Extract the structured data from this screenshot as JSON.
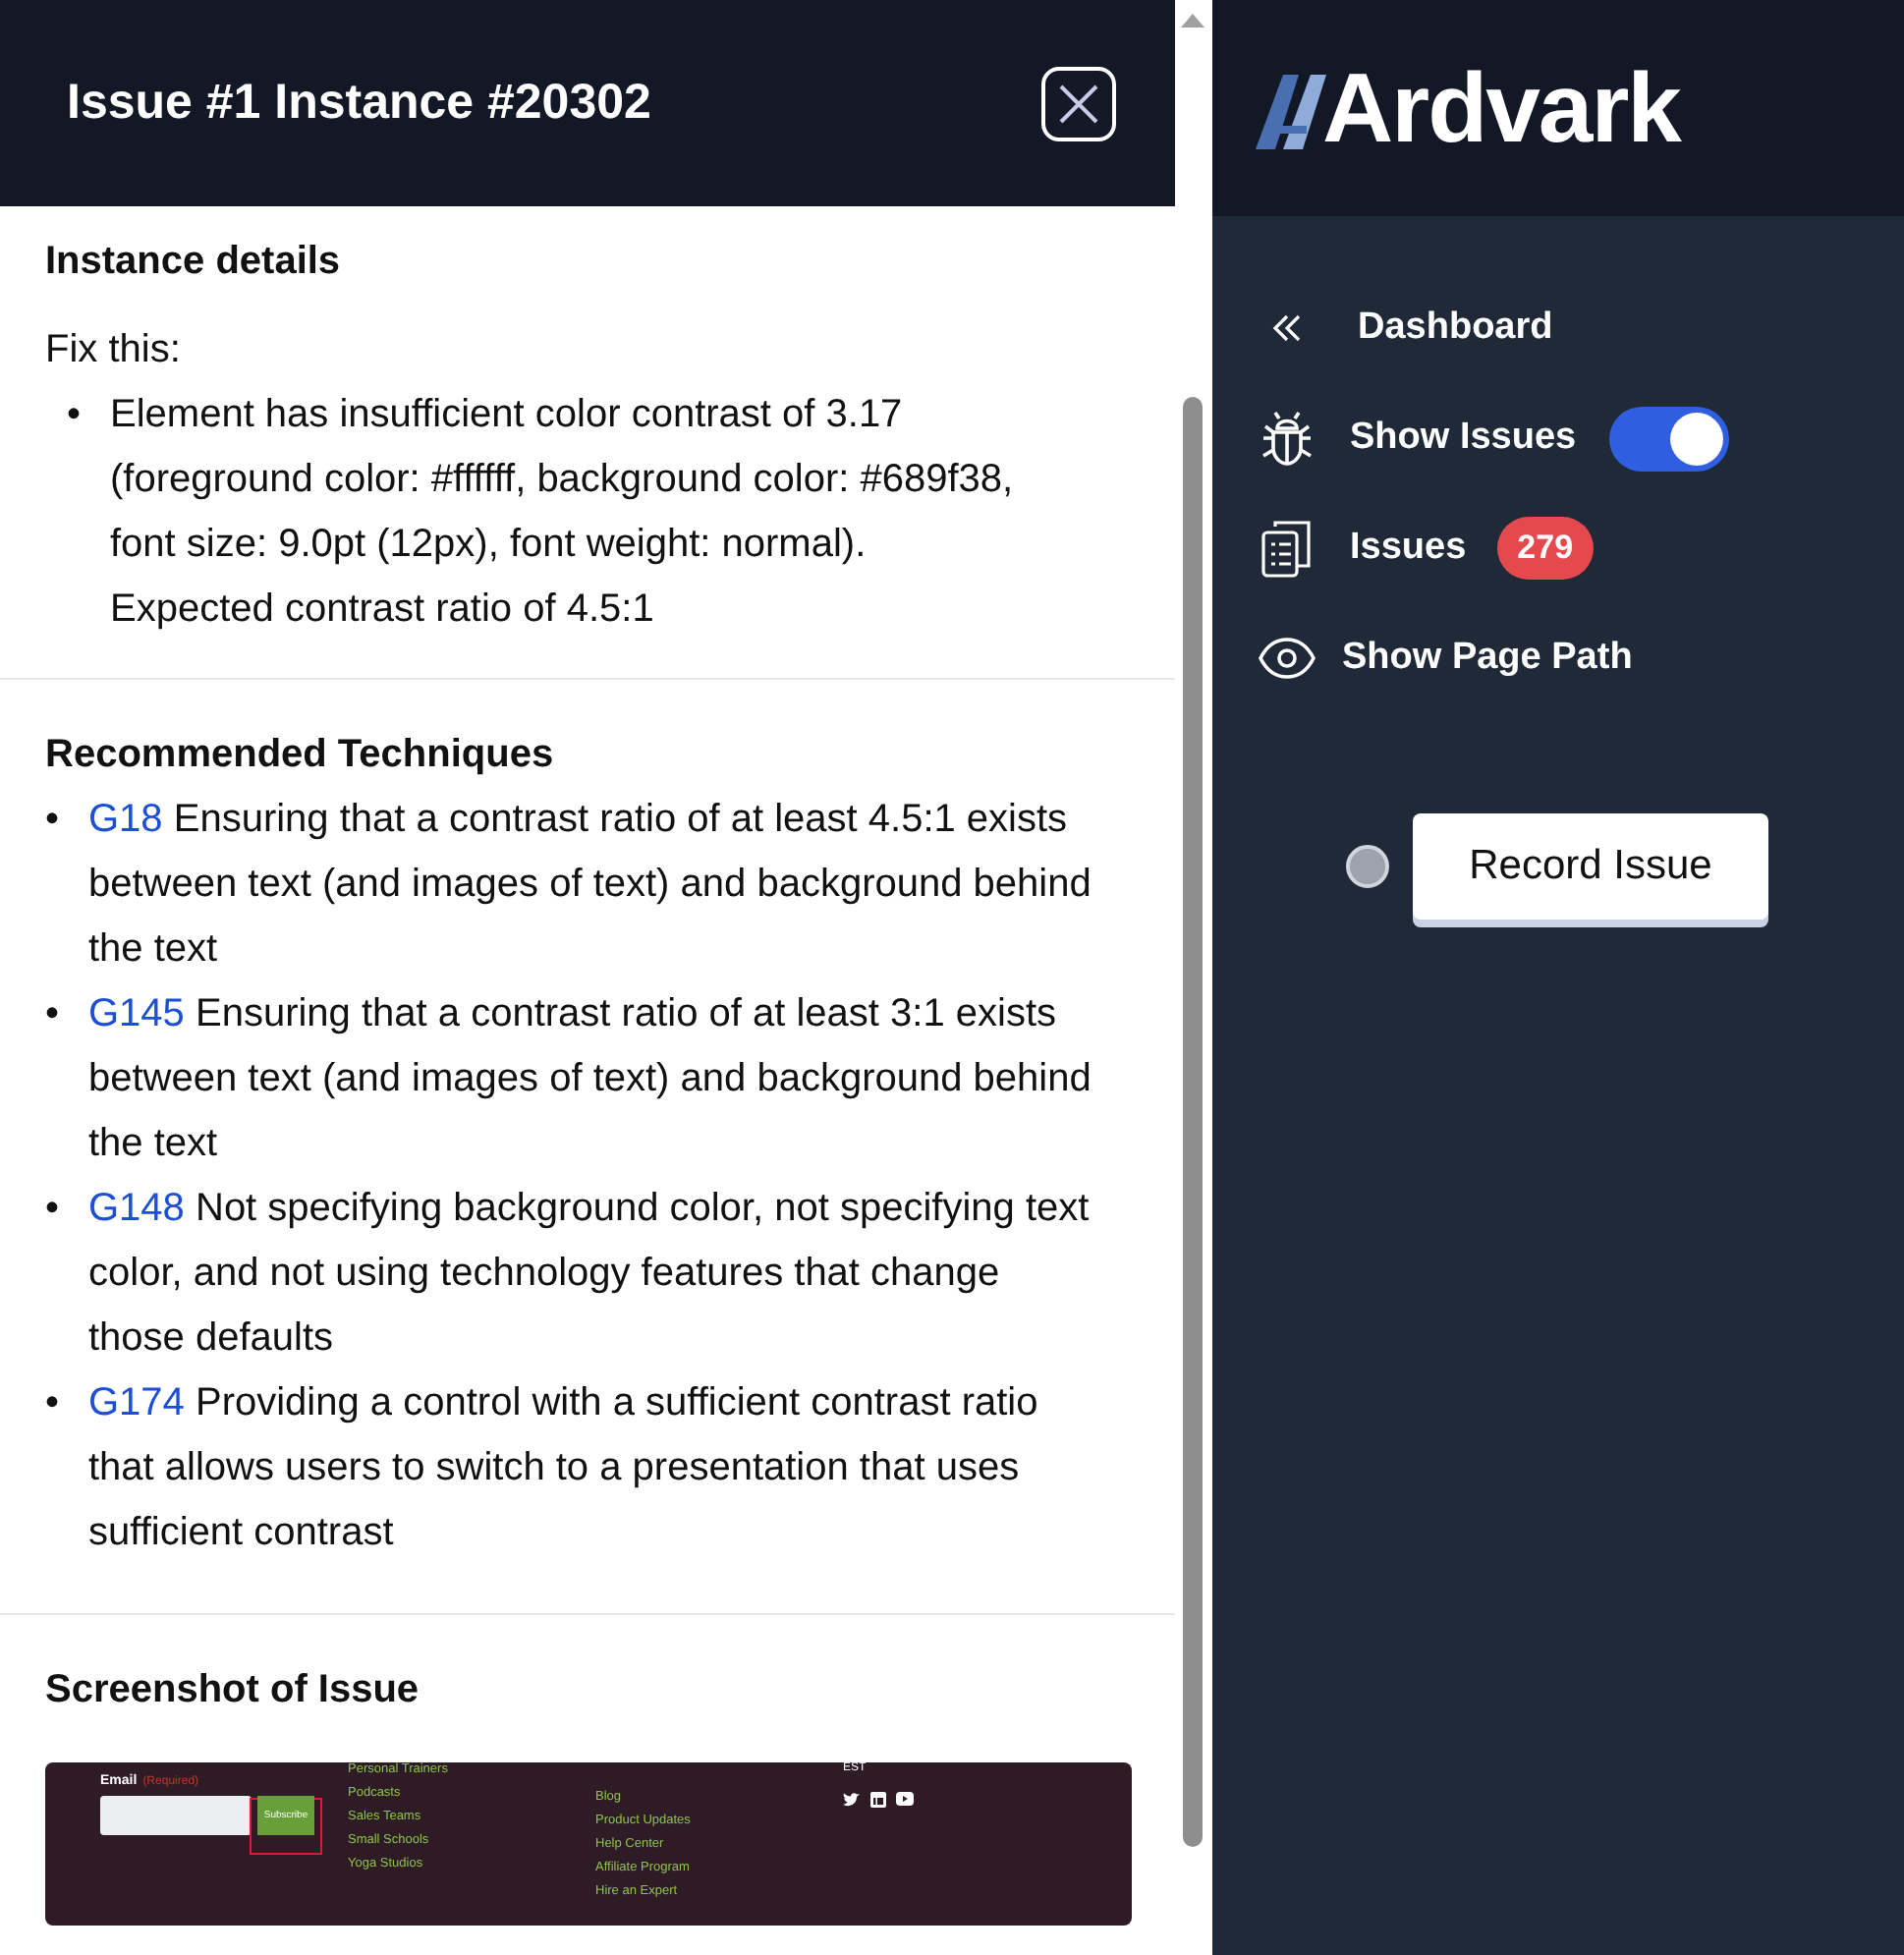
{
  "panel": {
    "title": "Issue #1 Instance #20302",
    "bullet": "•",
    "instance": {
      "heading": "Instance details",
      "fix_label": "Fix this:",
      "items": [
        "Element has insufficient color contrast of 3.17 (foreground color: #ffffff, background color: #689f38, font size: 9.0pt (12px), font weight: normal). Expected contrast ratio of 4.5:1"
      ]
    },
    "techniques": {
      "heading": "Recommended Techniques",
      "items": [
        {
          "code": "G18",
          "text": "Ensuring that a contrast ratio of at least 4.5:1 exists between text (and images of text) and background behind the text"
        },
        {
          "code": "G145",
          "text": "Ensuring that a contrast ratio of at least 3:1 exists between text (and images of text) and background behind the text"
        },
        {
          "code": "G148",
          "text": "Not specifying background color, not specifying text color, and not using technology features that change those defaults"
        },
        {
          "code": "G174",
          "text": "Providing a control with a sufficient contrast ratio that allows users to switch to a presentation that uses sufficient contrast"
        }
      ]
    },
    "screenshot": {
      "heading": "Screenshot of Issue",
      "email_label": "Email",
      "required": "(Required)",
      "button": "Subscribe",
      "column_1": [
        "Personal Trainers",
        "Podcasts",
        "Sales Teams",
        "Small Schools",
        "Yoga Studios"
      ],
      "column_2": [
        "Blog",
        "Product Updates",
        "Help Center",
        "Affiliate Program",
        "Hire an Expert"
      ],
      "column_3": "EST"
    }
  },
  "sidebar": {
    "logo": "Ardvark",
    "items": [
      {
        "kind": "link",
        "label": "Dashboard"
      },
      {
        "kind": "toggle",
        "label": "Show Issues",
        "on": true
      },
      {
        "kind": "badge",
        "label": "Issues",
        "badge": "279"
      },
      {
        "kind": "link2",
        "label": "Show Page Path"
      }
    ],
    "record_button": "Record Issue",
    "recording": false
  }
}
